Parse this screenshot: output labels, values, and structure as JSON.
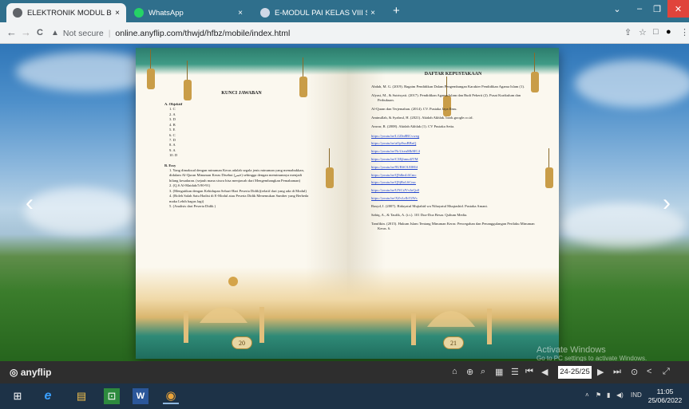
{
  "browser": {
    "tabs": [
      {
        "title": "ELEKTRONIK MODUL BERBASIS",
        "close": "×",
        "color": "#d9d9d9"
      },
      {
        "title": "WhatsApp",
        "close": "×",
        "color": "#25d366"
      },
      {
        "title": "E-MODUL PAI KELAS VIII SMPN",
        "close": "×",
        "color": "#6c8ebf"
      }
    ],
    "new_tab": "+",
    "window_controls": {
      "tabsearch": "⌄",
      "minimize": "–",
      "restore": "❐",
      "close": "✕"
    },
    "nav": {
      "back": "←",
      "forward": "→",
      "reload": "C"
    },
    "security_text": "Not secure",
    "url": "online.anyflip.com/thwjd/hfbz/mobile/index.html",
    "toolbar_icons": {
      "share": "⇪",
      "star": "☆",
      "sidepanel": "□",
      "profile": "●",
      "menu": "⋮"
    }
  },
  "viewer": {
    "prev_arrow": "‹",
    "next_arrow": "›",
    "left_page": {
      "title": "KUNCI JAWABAN",
      "section_a": "A.  Objektif",
      "answers": [
        "1.  C",
        "2.  A",
        "3.  D",
        "4.  B",
        "5.  E",
        "6.  C",
        "7.  D",
        "8.  A",
        "9.  A",
        "10. D"
      ],
      "section_b": "B.  Essy",
      "essays": [
        "1.  Yang dimaksud dengan minuman Keras adalah segala jenis minuman yang memabukkan, didalam Al-Quran Minuman Keras Disebut (خمر) sehingga dengan meminumnya menjadi hilang kesadaran. (sejauh mana siswa bisa menjawab dari Mengembangkan Pemahaman)",
        "2.  (Q.S Al-Maidah/5:90-91)",
        "3.  (Mengaitkan dengan Kehidupan Sehari-Hari Peserta Didik)(relatif dari yang ada di Modul)",
        "4.  (Boleh Salah Satu Hadist di E-Modul  atau Peserta Didik Menemukan Sumber yang Berbeda maka Lebih bagus lagi)",
        "5.  (Analisis dari Peserta Didik )"
      ],
      "page_number": "20"
    },
    "right_page": {
      "title": "DAFTAR KEPUSTAKAAN",
      "refs_top": [
        "Abdah, M. G. (2019). Bagaim Pendidikan Dalam Pengembangan Karakter Pendidikan Agama Islam (1).",
        "Alyasi, M., & Sutrisyati. (2017). Pendidikan Agama Islam dan Budi Pekerti (2). Pusat Kurikulum dan Perbukuan.",
        "Al-Quran dan Terjemahan. (2014). CV. Pustaka Jaya Ilmu.",
        "Aminullah, & Syahrul, H. (2021). Akidah Akhlak. book.google.co.id.",
        "Anwar, R. (2008). Akidah Akhlak (1). CV Pustaka Setia."
      ],
      "links": [
        "https://youtu.be/LGDn8RCvweg",
        "https://youtu.be/aOp9xuBBnQ",
        "https://youtu.be/NcUzeuMkMC4",
        "https://youtu.be/C3Ejhmu4JTM",
        "https://youtu.be/9UBSOUIIHI4",
        "https://youtu.be/Q9dlmL6Cmc",
        "https://youtu.be/Q9jBoL6Cmc",
        "https://youtu.be/UNCiJVvIoQo0",
        "https://youtu.be/XZvLrIbT2Wc"
      ],
      "refs_bottom": [
        "Rusyd, I. (2007). Bidayatul Mujtahid wa Nihayatul Muqtashid. Pustaka Amani.",
        "Sabiq, A., & Taufik, A. (t.t.). 101 Doa-Doa Besar. Qultum Media.",
        "Tamfikin. (2015). Hukum Islam Tentang Minuman Keras: Pencegahan dan Penanggulangan Perilaku Minuman Keras. 6."
      ],
      "page_number": "21"
    },
    "watermark_title": "Activate Windows",
    "watermark_sub": "Go to PC settings to activate Windows."
  },
  "flipbar": {
    "brand": "anyflip",
    "icons": {
      "home": "⌂",
      "zoom_in": "⊕",
      "search": "⌕",
      "thumbs": "▦",
      "toc": "☰",
      "first": "⏮",
      "prev": "◀",
      "next": "▶",
      "last": "⏭",
      "autoplay": "⊙",
      "share": "<",
      "fullscreen": "⤢"
    },
    "page_indicator": "24-25/25"
  },
  "taskbar": {
    "icons": {
      "start": "⊞",
      "ie": "e",
      "explorer": "▤",
      "store": "⊡",
      "word": "W",
      "chrome": "◉"
    },
    "tray": {
      "chevron": "˄",
      "flag": "⚑",
      "network": "▮",
      "volume": "◀)",
      "lang": "IND"
    },
    "time": "11:05",
    "date": "25/06/2022"
  }
}
